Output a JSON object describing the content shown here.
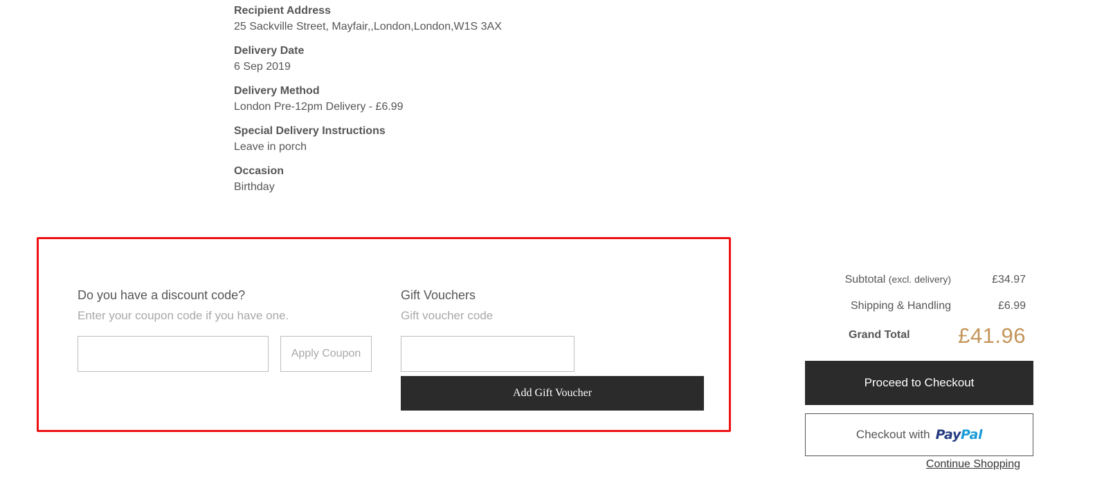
{
  "order_details": [
    {
      "label": "Recipient Address",
      "value": "25 Sackville Street, Mayfair,,London,London,W1S 3AX"
    },
    {
      "label": "Delivery Date",
      "value": "6 Sep 2019"
    },
    {
      "label": "Delivery Method",
      "value": "London Pre-12pm Delivery - £6.99"
    },
    {
      "label": "Special Delivery Instructions",
      "value": "Leave in porch"
    },
    {
      "label": "Occasion",
      "value": "Birthday"
    }
  ],
  "coupon": {
    "heading": "Do you have a discount code?",
    "subtext": "Enter your coupon code if you have one.",
    "input_value": "",
    "apply_label": "Apply Coupon"
  },
  "voucher": {
    "heading": "Gift Vouchers",
    "subtext": "Gift voucher code",
    "input_value": "",
    "add_label": "Add Gift Voucher"
  },
  "totals": {
    "subtotal_label": "Subtotal",
    "subtotal_note": "(excl. delivery)",
    "subtotal_value": "£34.97",
    "shipping_label": "Shipping & Handling",
    "shipping_value": "£6.99",
    "grand_label": "Grand Total",
    "grand_value": "£41.96"
  },
  "actions": {
    "checkout_label": "Proceed to Checkout",
    "paypal_prefix": "Checkout with",
    "paypal_logo_pay": "Pay",
    "paypal_logo_pal": "Pal",
    "continue_label": "Continue Shopping"
  },
  "colors": {
    "highlight_border": "#ee1111",
    "dark_button": "#2b2b2b",
    "grand_total": "#c4955a",
    "paypal_dark": "#253b80",
    "paypal_light": "#179bd7"
  }
}
